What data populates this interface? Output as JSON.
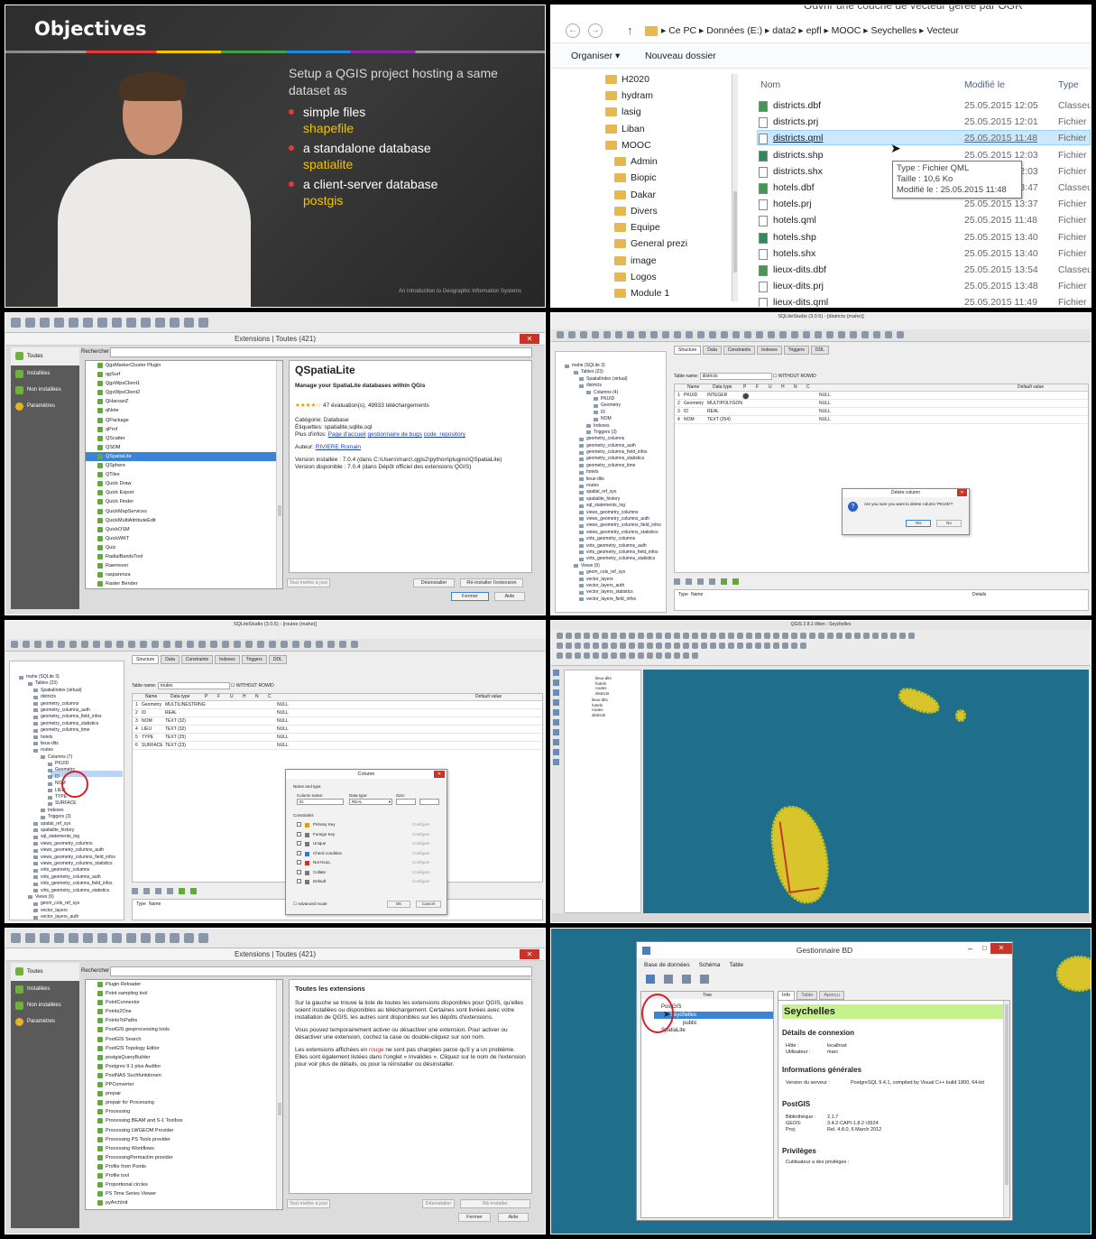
{
  "p1": {
    "title": "Objectives",
    "intro": "Setup a QGIS project hosting a same dataset as",
    "bullets": [
      {
        "text": "simple files",
        "sub": "shapefile"
      },
      {
        "text": "a standalone database",
        "sub": "spatialite"
      },
      {
        "text": "a client-server database",
        "sub": "postgis"
      }
    ],
    "footer": "An Introduction to Geographic Information Systems",
    "colors": {
      "accent": "#f5c400",
      "bullet": "#e53935"
    }
  },
  "p2": {
    "window_title": "Ouvrir une couche de vecteur gérée par OGR",
    "path": [
      "Ce PC",
      "Données (E:)",
      "data2",
      "epfl",
      "MOOC",
      "Seychelles",
      "Vecteur"
    ],
    "organize": "Organiser",
    "new_folder": "Nouveau dossier",
    "folders": [
      "H2020",
      "hydram",
      "lasig",
      "Liban",
      "MOOC",
      "Admin",
      "Biopic",
      "Dakar",
      "Divers",
      "Equipe",
      "General prezi",
      "image",
      "Logos",
      "Module 1"
    ],
    "columns": [
      "Nom",
      "Modifié le",
      "Type"
    ],
    "files": [
      {
        "name": "districts.dbf",
        "date": "25.05.2015 12:05",
        "type": "Classeu"
      },
      {
        "name": "districts.prj",
        "date": "25.05.2015 12:01",
        "type": "Fichier"
      },
      {
        "name": "districts.qml",
        "date": "25.05.2015 11:48",
        "type": "Fichier"
      },
      {
        "name": "districts.shp",
        "date": "25.05.2015 12:03",
        "type": "Fichier"
      },
      {
        "name": "districts.shx",
        "date": "25.05.2015 12:03",
        "type": "Fichier"
      },
      {
        "name": "hotels.dbf",
        "date": "25.05.2015 13:47",
        "type": "Classeu"
      },
      {
        "name": "hotels.prj",
        "date": "25.05.2015 13:37",
        "type": "Fichier"
      },
      {
        "name": "hotels.qml",
        "date": "25.05.2015 11:48",
        "type": "Fichier"
      },
      {
        "name": "hotels.shp",
        "date": "25.05.2015 13:40",
        "type": "Fichier"
      },
      {
        "name": "hotels.shx",
        "date": "25.05.2015 13:40",
        "type": "Fichier"
      },
      {
        "name": "lieux-dits.dbf",
        "date": "25.05.2015 13:54",
        "type": "Classeu"
      },
      {
        "name": "lieux-dits.prj",
        "date": "25.05.2015 13:48",
        "type": "Fichier"
      },
      {
        "name": "lieux-dits.qml",
        "date": "25.05.2015 11:49",
        "type": "Fichier"
      }
    ],
    "tooltip": {
      "type": "Type : Fichier QML",
      "size": "Taille : 10,6 Ko",
      "modified": "Modifié le : 25.05.2015 11:48"
    }
  },
  "p3": {
    "dialog_title": "Extensions | Toutes (421)",
    "nav": [
      "Toutes",
      "Installées",
      "Non installées",
      "Paramètres"
    ],
    "search_label": "Rechercher",
    "plugins": [
      "QgsMarkerCluster Plugin",
      "qgSurf",
      "QgsWpsClient1",
      "QgsWpsClient2",
      "QHarsanZ",
      "qNote",
      "QPackage",
      "qProf",
      "QScatter",
      "QSDM",
      "QSpatiaLite",
      "QSphere",
      "QTiles",
      "Quick Draw",
      "Quick Export",
      "Quick Finder",
      "QuickMapServices",
      "QuickMultiAttributeEdit",
      "QuickOSM",
      "QuickWKT",
      "Quiz",
      "RadialBandsTool",
      "Raemover",
      "rasparenza",
      "Raster Bender"
    ],
    "selected": "QSpatiaLite",
    "info_title": "QSpatiaLite",
    "info_subtitle": "Manage your SpatiaLite databases within QGis",
    "rating": "47 évaluation(s), 49933 téléchargements",
    "category": "Catégorie: Database",
    "tags": "Étiquettes: spatialite,sqlite,sql",
    "more_info_label": "Plus d'infos:",
    "links": [
      "Page d'accueil",
      "gestionnaire de bugs",
      "code_repository"
    ],
    "author_label": "Auteur:",
    "author": "RIVIERE Romain",
    "installed": "Version installée : 7.0.4 (dans C:\\Users\\marc\\.qgis2\\python\\plugins\\QSpatiaLite)",
    "available": "Version disponible : 7.0.4 (dans Dépôt officiel des extensions QGIS)",
    "buttons": [
      "Tout mettre à jour",
      "Désinstaller",
      "Ré-installer l'extension",
      "Fermer",
      "Aide"
    ]
  },
  "p4": {
    "window_title": "SQLiteStudio (3.0.5) - [districts (mahe)]",
    "tabs": [
      "Structure",
      "Data",
      "Constraints",
      "Indexes",
      "Triggers",
      "DDL"
    ],
    "table_name_label": "Table name:",
    "table_name": "districts",
    "without_rowid": "WITHOUT ROWID",
    "columns": [
      "Name",
      "Data type",
      "P",
      "F",
      "U",
      "H",
      "N",
      "C",
      "Default value"
    ],
    "rows": [
      {
        "n": "1",
        "name": "PKUID",
        "type": "INTEGER",
        "def": "NULL"
      },
      {
        "n": "2",
        "name": "Geometry",
        "type": "MULTIPOLYGON",
        "def": "NULL"
      },
      {
        "n": "3",
        "name": "ID",
        "type": "REAL",
        "def": "NULL"
      },
      {
        "n": "4",
        "name": "NOM",
        "type": "TEXT (254)",
        "def": "NULL"
      }
    ],
    "tree": [
      "mahe (SQLite 3)",
      "Tables (23)",
      "SpatialIndex (virtual)",
      "districts",
      "Columns (4)",
      "PKUID",
      "Geometry",
      "ID",
      "NOM",
      "Indexes",
      "Triggers (3)",
      "geometry_columns",
      "geometry_columns_auth",
      "geometry_columns_field_infos",
      "geometry_columns_statistics",
      "geometry_columns_time",
      "hotels",
      "lieux-dits",
      "routes",
      "spatial_ref_sys",
      "spatialite_history",
      "sql_statements_log",
      "views_geometry_columns",
      "views_geometry_columns_auth",
      "views_geometry_columns_field_infos",
      "views_geometry_columns_statistics",
      "virts_geometry_columns",
      "virts_geometry_columns_auth",
      "virts_geometry_columns_field_infos",
      "virts_geometry_columns_statistics",
      "Views (9)",
      "geom_cols_ref_sys",
      "vector_layers",
      "vector_layers_auth",
      "vector_layers_statistics",
      "vector_layers_field_infos"
    ],
    "dialog": {
      "title": "Delete column",
      "message": "Are you sure you want to delete column 'PKUID'?",
      "yes": "Yes",
      "no": "No"
    },
    "bottom": [
      "Type",
      "Name",
      "Details"
    ]
  },
  "p5": {
    "window_title": "SQLiteStudio (3.0.5) - [routes (mahe)]",
    "table_name": "routes",
    "rows": [
      {
        "n": "1",
        "name": "Geometry",
        "type": "MULTILINESTRING",
        "def": "NULL"
      },
      {
        "n": "2",
        "name": "ID",
        "type": "REAL",
        "def": "NULL"
      },
      {
        "n": "3",
        "name": "NOM",
        "type": "TEXT (32)",
        "def": "NULL"
      },
      {
        "n": "4",
        "name": "LIEU",
        "type": "TEXT (32)",
        "def": "NULL"
      },
      {
        "n": "5",
        "name": "TYPE",
        "type": "TEXT (25)",
        "def": "NULL"
      },
      {
        "n": "6",
        "name": "SURFACE",
        "type": "TEXT (23)",
        "def": "NULL"
      }
    ],
    "tree": [
      "mahe (SQLite 3)",
      "Tables (23)",
      "SpatialIndex (virtual)",
      "districts",
      "geometry_columns",
      "geometry_columns_auth",
      "geometry_columns_field_infos",
      "geometry_columns_statistics",
      "geometry_columns_time",
      "hotels",
      "lieux-dits",
      "routes",
      "Columns (7)",
      "PKUID",
      "Geometry",
      "ID",
      "NOM",
      "LIEU",
      "TYPE",
      "SURFACE",
      "Indexes",
      "Triggers (3)",
      "spatial_ref_sys",
      "spatialite_history",
      "sql_statements_log",
      "views_geometry_columns",
      "views_geometry_columns_auth",
      "views_geometry_columns_field_infos",
      "views_geometry_columns_statistics",
      "virts_geometry_columns",
      "virts_geometry_columns_auth",
      "virts_geometry_columns_field_infos",
      "virts_geometry_columns_statistics",
      "Views (9)",
      "geom_cols_ref_sys",
      "vector_layers",
      "vector_layers_auth",
      "vector_layers_statistics"
    ],
    "dialog": {
      "title": "Column",
      "group1": "Name and type",
      "name_label": "Column name:",
      "name_value": "ID",
      "type_label": "Data type:",
      "type_value": "REAL",
      "size_label": "Size:",
      "constraints_label": "Constraints",
      "constraints": [
        "Primary Key",
        "Foreign Key",
        "Unique",
        "Check condition",
        "Not NULL",
        "Collate",
        "Default"
      ],
      "configure": "Configure",
      "advanced": "Advanced mode",
      "ok": "OK",
      "cancel": "Cancel"
    }
  },
  "p6": {
    "window_title": "QGIS 2.8.1-Wien - Seychelles",
    "layers": [
      "lieux-dits",
      "hotels",
      "routes",
      "districts",
      "lieux-dits",
      "hotels",
      "routes",
      "districts"
    ]
  },
  "p7": {
    "dialog_title": "Extensions | Toutes (421)",
    "nav": [
      "Toutes",
      "Installées",
      "Non installées",
      "Paramètres"
    ],
    "search_label": "Rechercher",
    "plugins": [
      "Plugin Reloader",
      "Point sampling tool",
      "PointConnector",
      "Points2One",
      "PointsToPaths",
      "PostGIS geoprocessing tools",
      "PostGIS Search",
      "PostGIS Topology Editor",
      "postgisQueryBuilder",
      "Postgres 9.1 plus Auditor",
      "PostNAS Suchfunktionen",
      "PPConverter",
      "prepair",
      "prepair for Processing",
      "Processing",
      "Processing BEAM and S-1 Toolbox",
      "Processing LWGEOM Provider",
      "Processing PS Tools provider",
      "Processing Workflows",
      "ProcessingPermaclim provider",
      "Profile from Points",
      "Profile tool",
      "Proportional circles",
      "PS Time Series Viewer",
      "pyArchInit"
    ],
    "info_title": "Toutes les extensions",
    "para1": "Sur la gauche se trouve la liste de toutes les extensions disponibles pour QGIS, qu'elles soient installées ou disponibles au téléchargement. Certaines sont livrées avec votre installation de QGIS, les autres sont disponibles sur les dépôts d'extensions.",
    "para2": "Vous pouvez temporairement activer ou désactiver une extension. Pour activer ou désactiver une extension, cochez la case ou double-cliquez sur son nom.",
    "para3a": "Les extensions affichées en",
    "para3red": "rouge",
    "para3b": "ne sont pas chargées parce qu'il y a un problème. Elles sont également listées dans l'onglet « Invalides ». Cliquez sur le nom de l'extension pour voir plus de détails, ou pour la réinstaller ou désinstaller.",
    "buttons": [
      "Tout mettre à jour",
      "Désinstaller",
      "Ré-installer",
      "Fermer",
      "Aide"
    ]
  },
  "p8": {
    "window_title": "Gestionnaire BD",
    "menu": [
      "Base de données",
      "Schéma",
      "Table"
    ],
    "tree_label": "Tree",
    "tree": [
      "PostGIS",
      "Seychelles",
      "public",
      "SpatiaLite"
    ],
    "tabs": [
      "Info",
      "Table",
      "Aperçu"
    ],
    "db_title": "Seychelles",
    "sec_conn": "Détails de connexion",
    "host_label": "Hôte :",
    "host": "localhost",
    "user_label": "Utilisateur :",
    "user": "marc",
    "sec_general": "Informations générales",
    "server_label": "Version du serveur :",
    "server": "PostgreSQL 9.4.1, compiled by Visual C++ build 1800, 64-bit",
    "sec_postgis": "PostGIS",
    "lib_label": "Bibliothèque :",
    "lib": "2.1.7",
    "geos_label": "GEOS:",
    "geos": "3.4.2-CAPI-1.8.2 r3924",
    "proj_label": "Proj:",
    "proj": "Rel. 4.8.0, 6 March 2012",
    "sec_priv": "Privilèges",
    "priv_label": "Cutilisateur a des privilèges :"
  }
}
